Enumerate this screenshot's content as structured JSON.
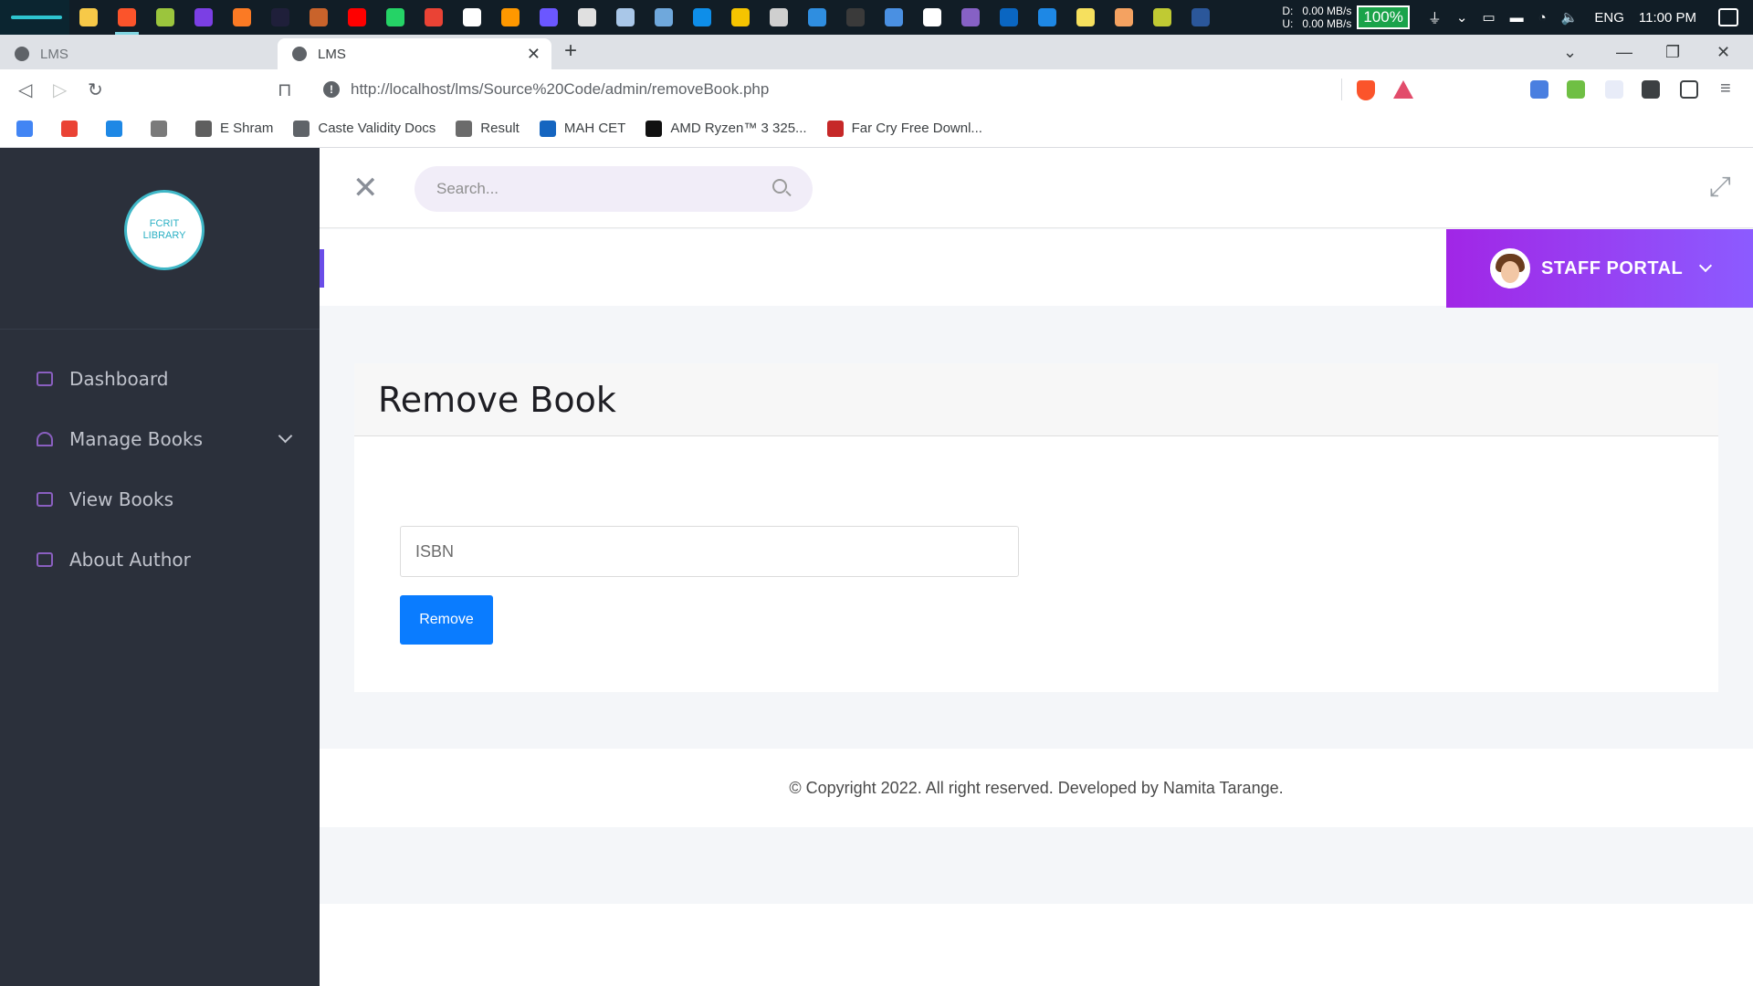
{
  "taskbar": {
    "pinned_icons": [
      {
        "name": "file-explorer-icon",
        "color": "#f7c948"
      },
      {
        "name": "brave-browser-icon",
        "color": "#fb542b",
        "active": true
      },
      {
        "name": "android-app-icon",
        "color": "#9bc53d"
      },
      {
        "name": "media-player-icon",
        "color": "#7b3fe4"
      },
      {
        "name": "xampp-icon",
        "color": "#fb7a24"
      },
      {
        "name": "intellij-icon",
        "color": "#1f1f3a"
      },
      {
        "name": "console-icon",
        "color": "#c9632b"
      },
      {
        "name": "youtube-icon",
        "color": "#ff0000"
      },
      {
        "name": "whatsapp-icon",
        "color": "#25d366"
      },
      {
        "name": "gmail-icon",
        "color": "#ea4335"
      },
      {
        "name": "google-icon",
        "color": "#ffffff"
      },
      {
        "name": "sublime-icon",
        "color": "#ff9800"
      },
      {
        "name": "phpstorm-icon",
        "color": "#6b57ff"
      },
      {
        "name": "calculator-icon",
        "color": "#e0e0e0"
      },
      {
        "name": "notes-icon",
        "color": "#a9c7e8"
      },
      {
        "name": "vpn-icon",
        "color": "#6fa8dc"
      },
      {
        "name": "teamviewer-icon",
        "color": "#0e8ee9"
      },
      {
        "name": "sun-app-icon",
        "color": "#f5c400"
      },
      {
        "name": "settings-gear-icon",
        "color": "#cfcfcf"
      },
      {
        "name": "vscode-icon",
        "color": "#2f8ee0"
      },
      {
        "name": "obs-icon",
        "color": "#3a3a3a"
      },
      {
        "name": "shield-app-icon",
        "color": "#4a90e2"
      },
      {
        "name": "github-icon",
        "color": "#ffffff"
      },
      {
        "name": "visual-studio-icon",
        "color": "#8661c5"
      },
      {
        "name": "linkedin-icon",
        "color": "#0a66c2"
      },
      {
        "name": "lapp-icon",
        "color": "#1e88e5"
      },
      {
        "name": "sticky-notes-icon",
        "color": "#f6e05e"
      },
      {
        "name": "video-app-icon",
        "color": "#f4a261"
      },
      {
        "name": "c-app-icon",
        "color": "#c0ca33"
      },
      {
        "name": "word-icon",
        "color": "#2b579a"
      }
    ],
    "net_labels": [
      "D:",
      "U:"
    ],
    "net_down": "0.00 MB/s",
    "net_up": "0.00 MB/s",
    "battery": "100%",
    "language": "ENG",
    "time": "11:00 PM"
  },
  "browser": {
    "tabs": [
      {
        "title": "LMS"
      },
      {
        "title": "LMS"
      }
    ],
    "url": "http://localhost/lms/Source%20Code/admin/removeBook.php",
    "bookmarks": [
      {
        "label": "",
        "icon": "google-icon",
        "color": "#4285f4"
      },
      {
        "label": "",
        "icon": "gmail-icon",
        "color": "#ea4335"
      },
      {
        "label": "",
        "icon": "t-bookmark-icon",
        "color": "#1e88e5"
      },
      {
        "label": "",
        "icon": "emblem-icon",
        "color": "#7a7a7a"
      },
      {
        "label": "E Shram",
        "icon": "emblem-icon",
        "color": "#5f5f5f"
      },
      {
        "label": "Caste Validity Docs",
        "icon": "globe-icon",
        "color": "#5f6368"
      },
      {
        "label": "Result",
        "icon": "seal-icon",
        "color": "#6b6b6b"
      },
      {
        "label": "MAH CET",
        "icon": "cet-icon",
        "color": "#1565c0"
      },
      {
        "label": "AMD Ryzen™ 3 325...",
        "icon": "amd-icon",
        "color": "#111111"
      },
      {
        "label": "Far Cry Free Downl...",
        "icon": "gamepad-icon",
        "color": "#c62828"
      }
    ]
  },
  "sidebar": {
    "logo_lines": [
      "FCRIT",
      "LIBRARY"
    ],
    "items": [
      {
        "label": "Dashboard",
        "has_submenu": false
      },
      {
        "label": "Manage Books",
        "has_submenu": true
      },
      {
        "label": "View Books",
        "has_submenu": false
      },
      {
        "label": "About Author",
        "has_submenu": false
      }
    ]
  },
  "topbar": {
    "search_placeholder": "Search...",
    "portal_label": "STAFF PORTAL"
  },
  "form": {
    "title": "Remove Book",
    "isbn_placeholder": "ISBN",
    "submit_label": "Remove"
  },
  "footer": {
    "text": "© Copyright 2022. All right reserved. Developed by Namita Tarange."
  },
  "colors": {
    "sidebar_bg": "#2b303b",
    "portal_gradient_start": "#a126e6",
    "portal_gradient_end": "#8c5bff",
    "button_primary": "#0a7cff"
  }
}
